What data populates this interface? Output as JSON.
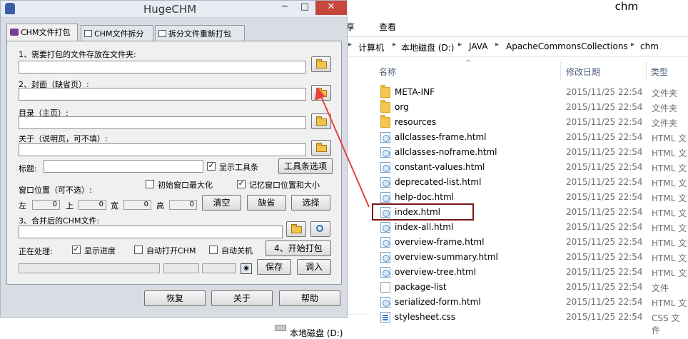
{
  "explorer": {
    "title": "chm",
    "ribbon": {
      "tab_partial": "享",
      "view": "查看"
    },
    "breadcrumb": [
      "计算机",
      "本地磁盘 (D:)",
      "JAVA",
      "ApacheCommonsCollections",
      "chm"
    ],
    "columns": {
      "name": "名称",
      "date": "修改日期",
      "type": "类型"
    },
    "files": [
      {
        "name": "META-INF",
        "date": "2015/11/25 22:54",
        "type": "文件夹",
        "icon": "folder-icon"
      },
      {
        "name": "org",
        "date": "2015/11/25 22:54",
        "type": "文件夹",
        "icon": "folder-icon"
      },
      {
        "name": "resources",
        "date": "2015/11/25 22:54",
        "type": "文件夹",
        "icon": "folder-icon"
      },
      {
        "name": "allclasses-frame.html",
        "date": "2015/11/25 22:54",
        "type": "HTML 文",
        "icon": "html-file-icon"
      },
      {
        "name": "allclasses-noframe.html",
        "date": "2015/11/25 22:54",
        "type": "HTML 文",
        "icon": "html-file-icon"
      },
      {
        "name": "constant-values.html",
        "date": "2015/11/25 22:54",
        "type": "HTML 文",
        "icon": "html-file-icon"
      },
      {
        "name": "deprecated-list.html",
        "date": "2015/11/25 22:54",
        "type": "HTML 文",
        "icon": "html-file-icon"
      },
      {
        "name": "help-doc.html",
        "date": "2015/11/25 22:54",
        "type": "HTML 文",
        "icon": "html-file-icon"
      },
      {
        "name": "index.html",
        "date": "2015/11/25 22:54",
        "type": "HTML 文",
        "icon": "html-file-icon"
      },
      {
        "name": "index-all.html",
        "date": "2015/11/25 22:54",
        "type": "HTML 文",
        "icon": "html-file-icon"
      },
      {
        "name": "overview-frame.html",
        "date": "2015/11/25 22:54",
        "type": "HTML 文",
        "icon": "html-file-icon"
      },
      {
        "name": "overview-summary.html",
        "date": "2015/11/25 22:54",
        "type": "HTML 文",
        "icon": "html-file-icon"
      },
      {
        "name": "overview-tree.html",
        "date": "2015/11/25 22:54",
        "type": "HTML 文",
        "icon": "html-file-icon"
      },
      {
        "name": "package-list",
        "date": "2015/11/25 22:54",
        "type": "文件",
        "icon": "file-icon"
      },
      {
        "name": "serialized-form.html",
        "date": "2015/11/25 22:54",
        "type": "HTML 文",
        "icon": "html-file-icon"
      },
      {
        "name": "stylesheet.css",
        "date": "2015/11/25 22:54",
        "type": "CSS 文件",
        "icon": "css-file-icon"
      }
    ],
    "nav_drive": "本地磁盘 (D:)",
    "highlight_color": "#7b1515",
    "arrow_color": "#e8413c"
  },
  "huge": {
    "title": "HugeCHM",
    "tabs": [
      "CHM文件打包",
      "CHM文件拆分",
      "拆分文件重新打包"
    ],
    "label1": "1、需要打包的文件存放在文件夹:",
    "label2": "2、封面（缺省页）:",
    "label_toc": "目录（主页）:",
    "label_about": "关于（说明页，可不填）:",
    "label_title": "标题:",
    "show_toolbar": "显示工具条",
    "toolbar_options": "工具条选项",
    "init_max": "初始窗口最大化",
    "remember_pos": "记忆窗口位置和大小",
    "win_pos": "窗口位置（可不选）:",
    "pos": {
      "left": "左",
      "top": "上",
      "width": "宽",
      "height": "高",
      "left_val": "0",
      "top_val": "0",
      "width_val": "0",
      "height_val": "0"
    },
    "clear": "清空",
    "default": "缺省",
    "choose": "选择",
    "label3": "3、合并后的CHM文件:",
    "processing": "正在处理:",
    "show_progress": "显示进度",
    "auto_open": "自动打开CHM",
    "auto_shutdown": "自动关机",
    "start_pack": "4、开始打包",
    "save": "保存",
    "load": "调入",
    "restore": "恢复",
    "about": "关于",
    "help": "帮助",
    "close_glyph": "✕",
    "min_glyph": "─",
    "max_glyph": "□"
  }
}
